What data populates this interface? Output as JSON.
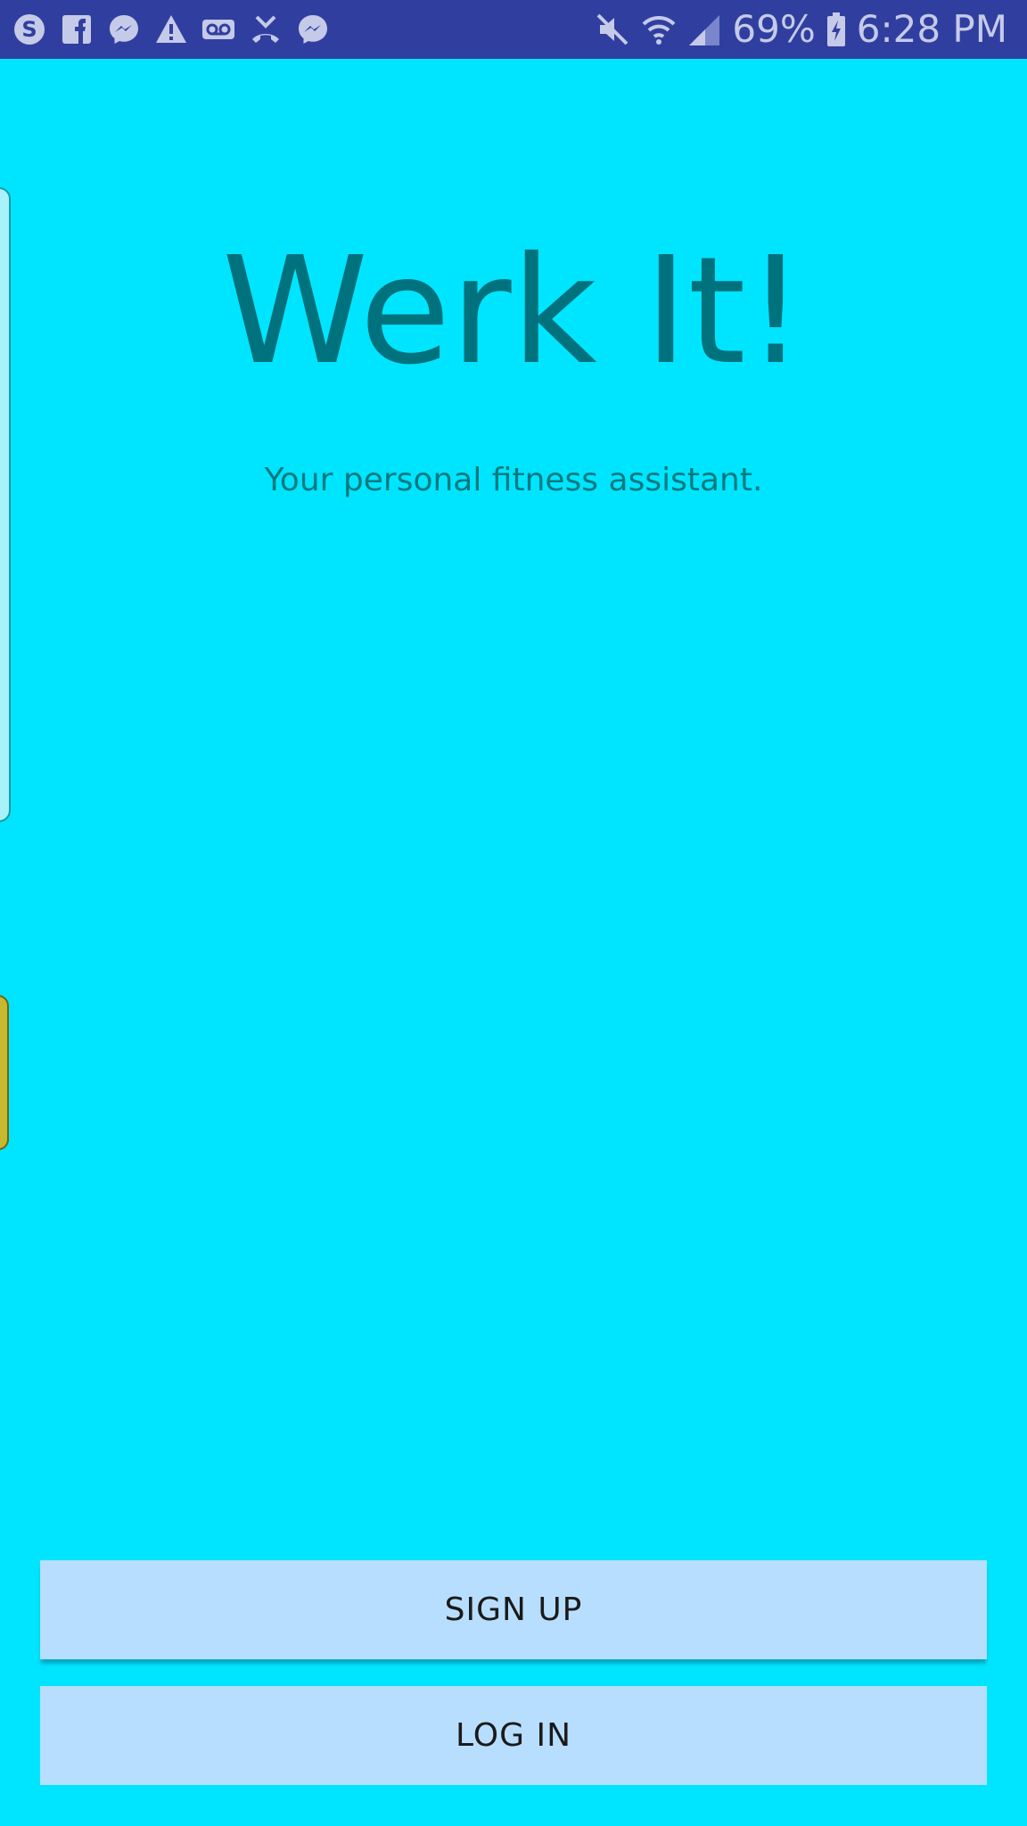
{
  "status_bar": {
    "left_icons": [
      "skype-icon",
      "facebook-icon",
      "messenger-icon",
      "warning-icon",
      "voicemail-icon",
      "missed-call-icon",
      "messenger-icon"
    ],
    "right_icons": [
      "mute-icon",
      "wifi-icon",
      "signal-icon",
      "battery-charging-icon"
    ],
    "battery": "69%",
    "time": "6:28 PM",
    "bg_color": "#303F9F"
  },
  "app": {
    "title": "Werk It!",
    "subtitle": "Your personal fitness assistant.",
    "bg_color": "#00E5FF",
    "title_color": "#00727D"
  },
  "buttons": {
    "signup_label": "SIGN UP",
    "login_label": "LOG IN",
    "button_color": "#B8DEFF"
  },
  "overlays": {
    "edge_panel_handle": "edge-panel-handle",
    "edge_handle_yellow": "edge-handle-yellow"
  }
}
